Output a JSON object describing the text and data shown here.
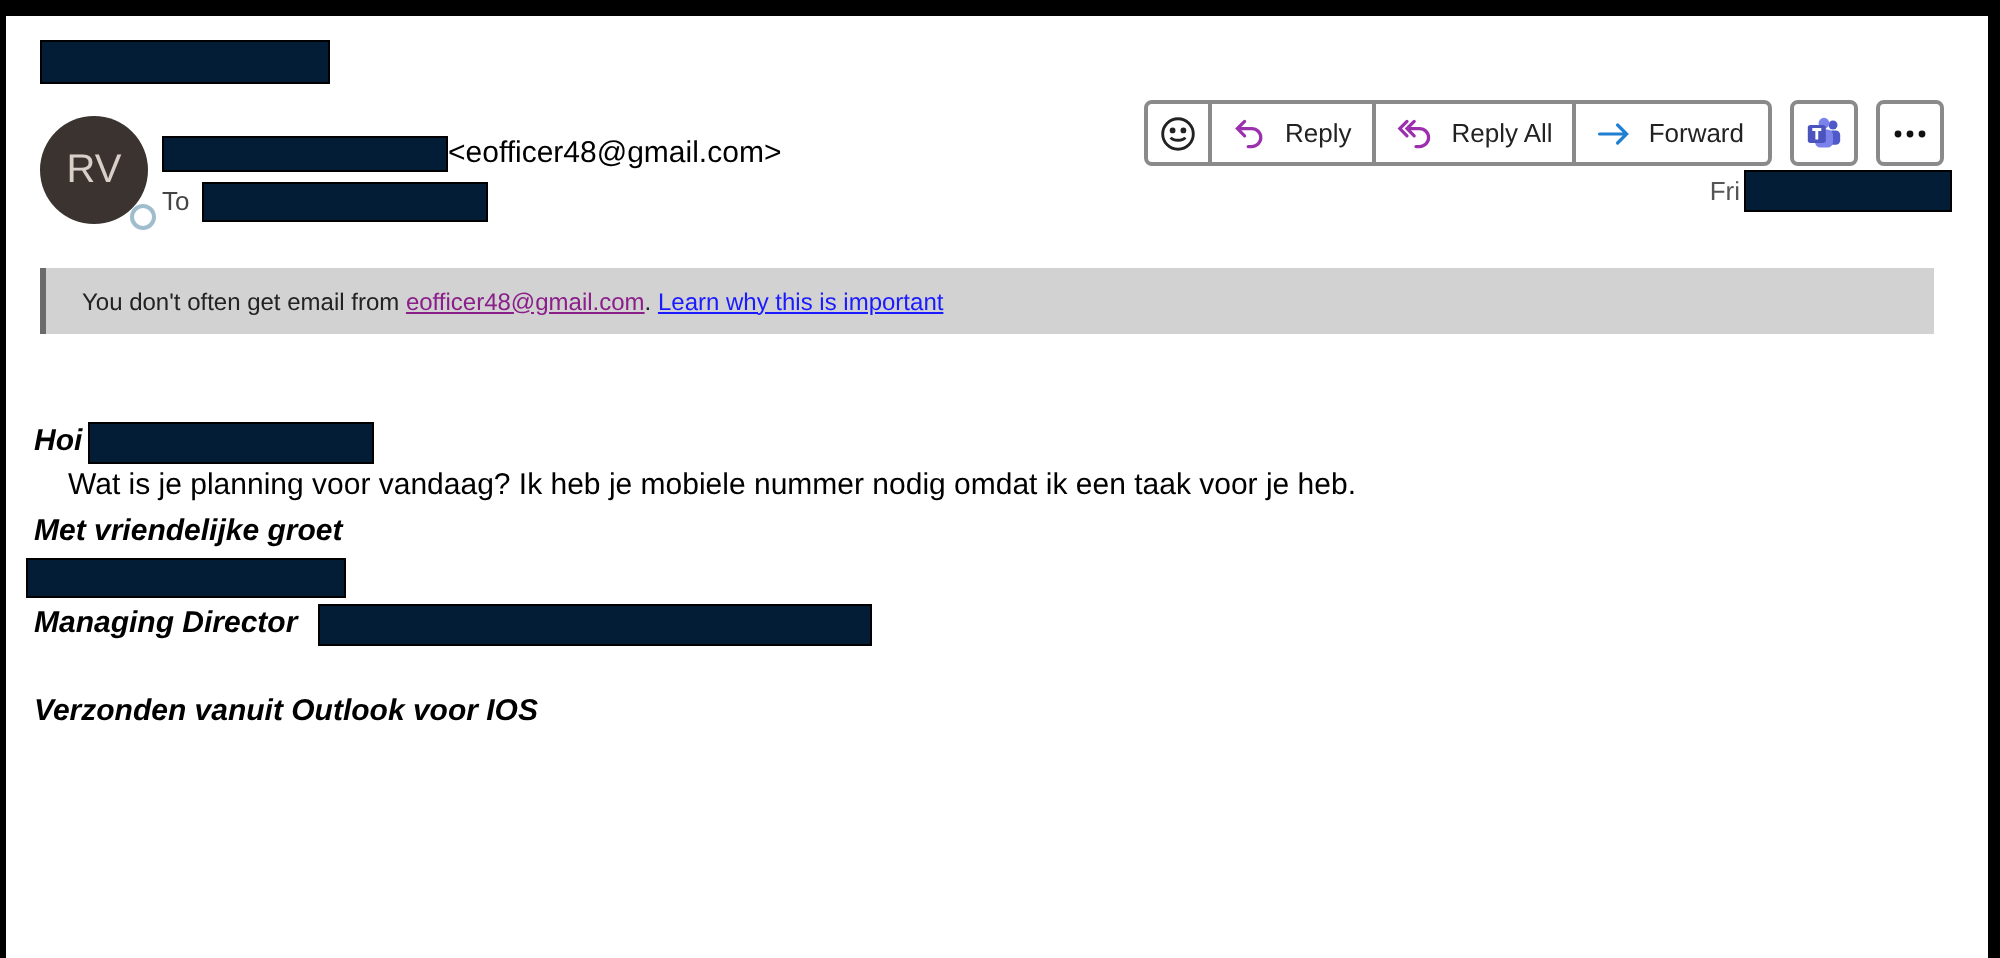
{
  "sender": {
    "initials": "RV",
    "email": "<eofficer48@gmail.com>",
    "to_label": "To"
  },
  "toolbar": [
    {
      "kind": "emoji"
    },
    {
      "kind": "reply",
      "label": "Reply"
    },
    {
      "kind": "reply_all",
      "label": "Reply All"
    },
    {
      "kind": "forward",
      "label": "Forward"
    }
  ],
  "extra_buttons": [
    {
      "kind": "teams"
    },
    {
      "kind": "more"
    }
  ],
  "date_prefix": "Fri",
  "banner": {
    "text": "You don't often get email from ",
    "sender_link": "eofficer48@gmail.com",
    "separator": ".",
    "learn_link": "Learn why this is important"
  },
  "body": [
    {
      "kind": "greeting",
      "text": "Hoi"
    },
    {
      "kind": "paragraph",
      "text": "Wat is je planning voor vandaag? Ik heb je mobiele nummer nodig omdat ik een taak voor je heb."
    },
    {
      "kind": "closing",
      "text": "Met vriendelijke groet"
    },
    {
      "kind": "redacted_line"
    },
    {
      "kind": "title",
      "text": "Managing Director"
    },
    {
      "kind": "spacer"
    },
    {
      "kind": "signature",
      "text": "Verzonden vanuit Outlook voor IOS"
    }
  ]
}
